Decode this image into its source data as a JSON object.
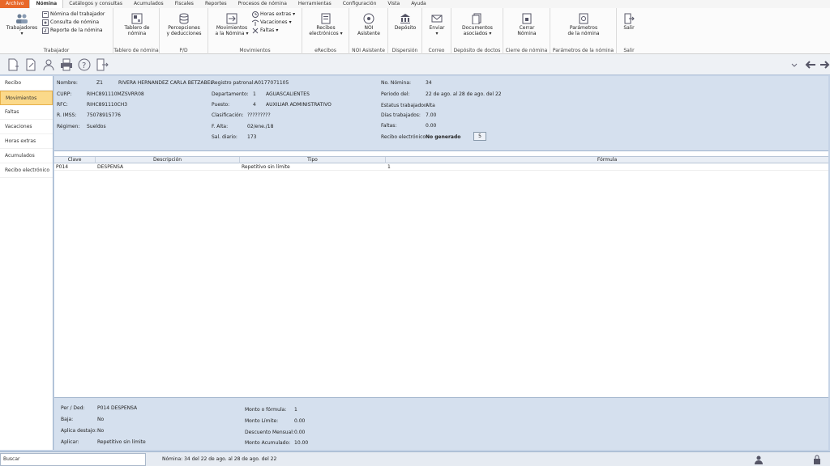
{
  "menu": [
    "Archivo",
    "Nómina",
    "Catálogos y consultas",
    "Acumulados",
    "Fiscales",
    "Reportes",
    "Procesos de nómina",
    "Herramientas",
    "Configuración",
    "Vista",
    "Ayuda"
  ],
  "ribbon": {
    "trabajador": {
      "big": "Trabajadores",
      "nomina_trabajador": "Nómina del trabajador",
      "consulta": "Consulta de nómina",
      "reporte": "Reporte de la nómina",
      "caption": "Trabajador"
    },
    "tablero": {
      "label1": "Tablero de",
      "label2": "nómina",
      "caption": "Tablero de nómina"
    },
    "pd": {
      "label1": "Percepciones",
      "label2": "y deducciones",
      "caption": "P/D"
    },
    "movimientos": {
      "label1": "Movimientos",
      "label2": "a la Nómina",
      "horas": "Horas extras",
      "vacaciones": "Vacaciones",
      "faltas": "Faltas",
      "caption": "Movimientos"
    },
    "erecibos": {
      "label1": "Recibos",
      "label2": "electrónicos",
      "caption": "eRecibos"
    },
    "noi": {
      "label1": "NOI",
      "label2": "Asistente",
      "caption": "NOI Asistente"
    },
    "dispersion": {
      "label1": "Depósito",
      "caption": "Dispersión"
    },
    "correo": {
      "label1": "Enviar",
      "caption": "Correo"
    },
    "docs": {
      "label1": "Documentos",
      "label2": "asociados",
      "caption": "Depósito de doctos"
    },
    "cierre": {
      "label1": "Cerrar",
      "label2": "Nómina",
      "caption": "Cierre de nómina"
    },
    "params": {
      "label1": "Parámetros",
      "label2": "de la nómina",
      "caption": "Parámetros de la nómina"
    },
    "salir": {
      "label1": "Salir",
      "caption": "Salir"
    }
  },
  "nav": [
    "Recibo",
    "Movimientos",
    "Faltas",
    "Vacaciones",
    "Horas extras",
    "Acumulados",
    "Recibo electrónico"
  ],
  "employee": {
    "nombre_label": "Nombre:",
    "nombre_num": "Z1",
    "nombre": "RIVERA HERNANDEZ CARLA BETZABEL",
    "curp_label": "CURP:",
    "curp": "RIHC891110MZSVRR08",
    "rfc_label": "RFC:",
    "rfc": "RIHC891110CH3",
    "imss_label": "R. IMSS:",
    "imss": "75078915776",
    "regimen_label": "Régimen:",
    "regimen": "Sueldos",
    "registro_label": "Registro patronal:",
    "registro": "A0177071105",
    "depto_label": "Departamento:",
    "depto_num": "1",
    "depto": "AGUASCALIENTES",
    "puesto_label": "Puesto:",
    "puesto_num": "4",
    "puesto": "AUXILIAR ADMINISTRATIVO",
    "clasif_label": "Clasificación:",
    "clasif": "?????????",
    "falta_label": "F. Alta:",
    "falta": "02/ene./18",
    "sal_label": "Sal. diario:",
    "sal": "173",
    "nomina_label": "No. Nómina:",
    "nomina": "34",
    "periodo_label": "Periodo del:",
    "periodo": "22 de ago. al 28 de ago. del 22",
    "estatus_label": "Estatus trabajador:",
    "estatus": "Alta",
    "dias_label": "Días trabajados:",
    "dias": "7.00",
    "faltas_label": "Faltas:",
    "faltas": "0.00",
    "recibo_label": "Recibo electrónico:",
    "recibo": "No generado",
    "recibo_btn": "5"
  },
  "grid": {
    "headers": [
      "Clave",
      "Descripción",
      "Tipo",
      "Fórmula"
    ],
    "rows": [
      {
        "clave": "P014",
        "desc": "DESPENSA",
        "tipo": "Repetitivo sin límite",
        "formula": "1"
      }
    ]
  },
  "detail": {
    "perded_label": "Per / Ded:",
    "perded": "P014 DESPENSA",
    "baja_label": "Baja:",
    "baja": "No",
    "destajo_label": "Aplica destajo:",
    "destajo": "No",
    "aplicar_label": "Aplicar:",
    "aplicar": "Repetitivo sin límite",
    "monto_formula_label": "Monto o fórmula:",
    "monto_formula": "1",
    "monto_limite_label": "Monto Límite:",
    "monto_limite": "0.00",
    "desc_mensual_label": "Descuento Mensual:",
    "desc_mensual": "0.00",
    "monto_acum_label": "Monto Acumulado:",
    "monto_acum": "10.00"
  },
  "status": {
    "search_placeholder": "Buscar",
    "text": "Nómina: 34 del 22 de ago. al 28 de ago. del 22"
  }
}
